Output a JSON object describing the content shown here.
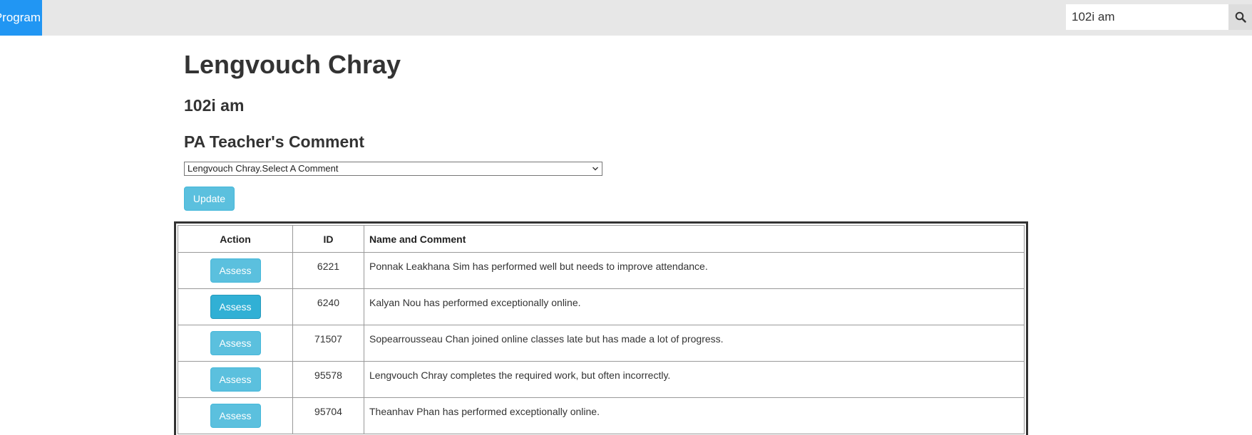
{
  "topbar": {
    "brand_label": "Program",
    "search": {
      "value": "102i am",
      "icon": "search-icon"
    }
  },
  "page": {
    "title": "Lengvouch Chray",
    "subtitle": "102i am",
    "section_heading": "PA Teacher's Comment",
    "comment_select_value": "Lengvouch Chray.Select A Comment",
    "update_label": "Update"
  },
  "table": {
    "headers": {
      "action": "Action",
      "id": "ID",
      "name_comment": "Name and Comment"
    },
    "rows": [
      {
        "action": "Assess",
        "id": "6221",
        "comment": "Ponnak Leakhana Sim has performed well but needs to improve attendance."
      },
      {
        "action": "Assess",
        "id": "6240",
        "comment": "Kalyan Nou has performed exceptionally online."
      },
      {
        "action": "Assess",
        "id": "71507",
        "comment": "Sopearrousseau Chan joined online classes late but has made a lot of progress."
      },
      {
        "action": "Assess",
        "id": "95578",
        "comment": "Lengvouch Chray completes the required work, but often incorrectly."
      },
      {
        "action": "Assess",
        "id": "95704",
        "comment": "Theanhav Phan has performed exceptionally online."
      }
    ]
  },
  "colors": {
    "topbar_bg": "#e7e7e7",
    "brand_bg": "#2196f3",
    "button_info": "#5bc0de",
    "button_info_active": "#31b0d5"
  }
}
